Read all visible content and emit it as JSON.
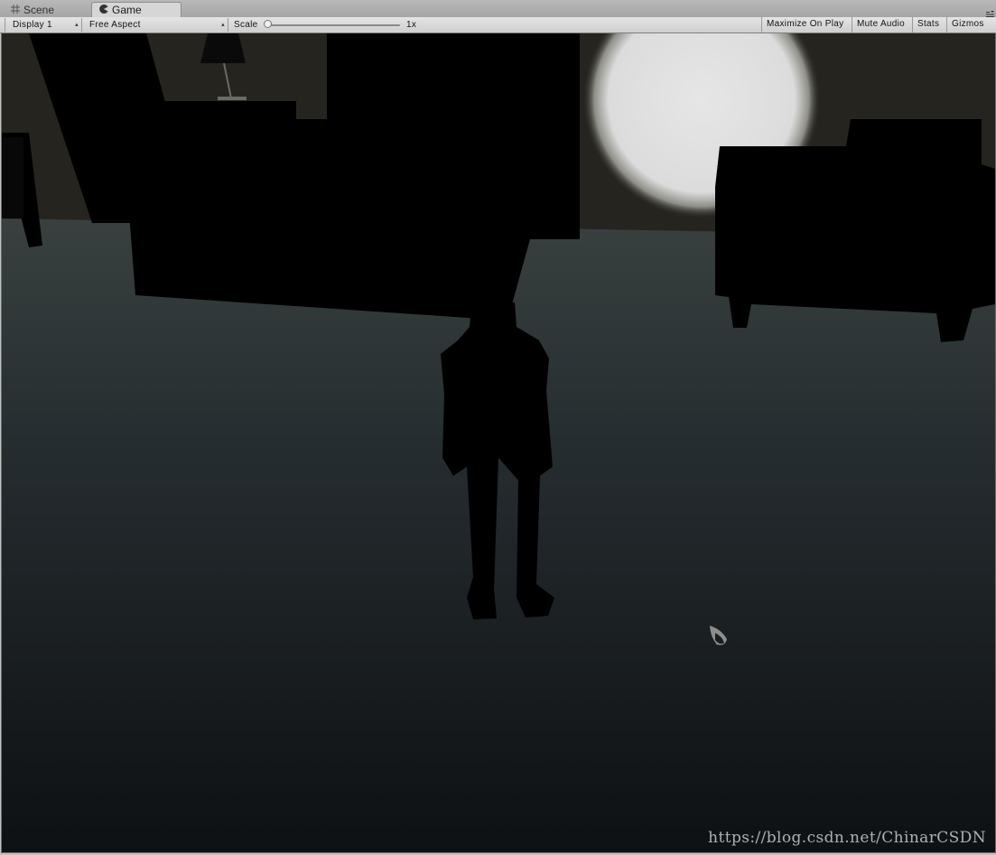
{
  "tabs": [
    {
      "label": "Scene",
      "icon": "grid-icon",
      "active": false
    },
    {
      "label": "Game",
      "icon": "pacman-icon",
      "active": true
    }
  ],
  "toolbar": {
    "display_value": "Display 1",
    "aspect_value": "Free Aspect",
    "scale_label": "Scale",
    "scale_value": "1x",
    "scale_level": 0,
    "maximize_label": "Maximize On Play",
    "mute_label": "Mute Audio",
    "stats_label": "Stats",
    "gizmos_label": "Gizmos"
  },
  "viewport": {
    "watermark": "https://blog.csdn.net/ChinarCSDN",
    "colors": {
      "floor": "#2e3639",
      "wall": "#262520",
      "silhouette": "#000000",
      "moon": "#e8e8e8"
    }
  }
}
